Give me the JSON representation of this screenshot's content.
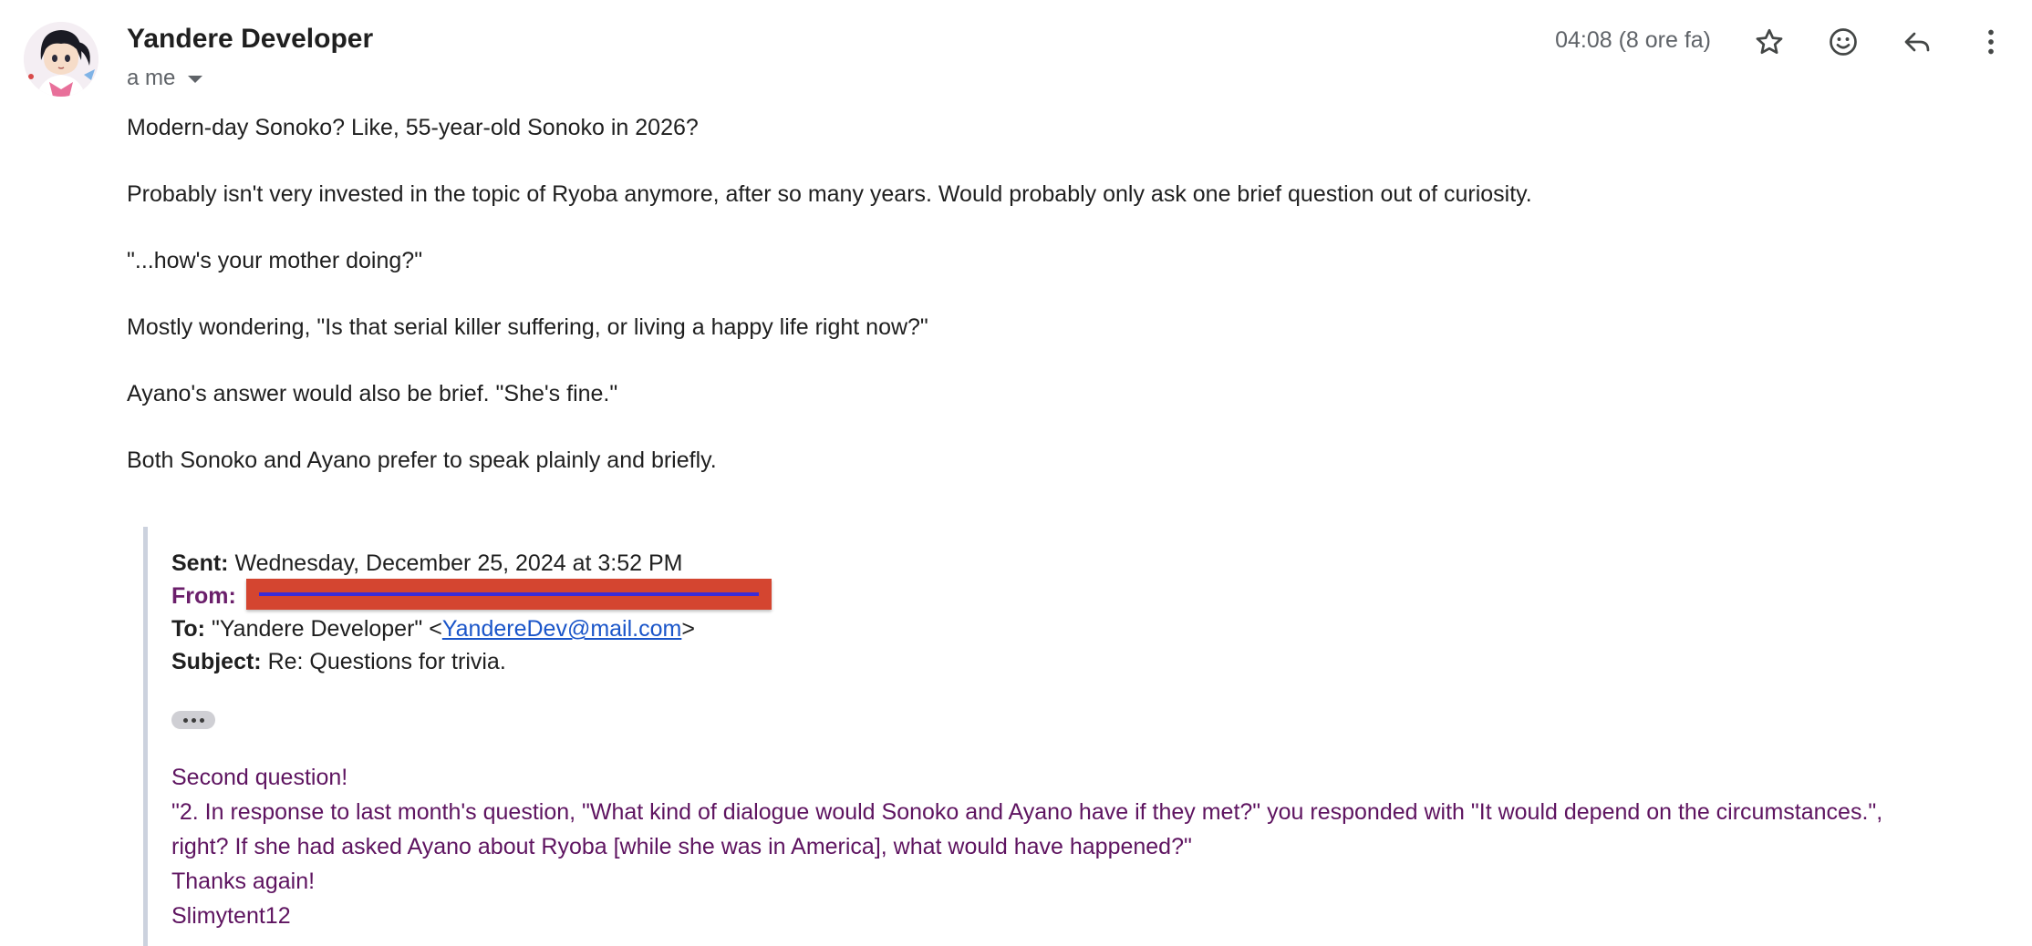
{
  "header": {
    "sender_name": "Yandere Developer",
    "recipient_label": "a me",
    "timestamp": "04:08 (8 ore fa)"
  },
  "actions": [
    {
      "name": "star",
      "icon": "star-icon"
    },
    {
      "name": "react",
      "icon": "emoji-icon"
    },
    {
      "name": "reply",
      "icon": "reply-icon"
    },
    {
      "name": "more",
      "icon": "more-vert-icon"
    }
  ],
  "body": {
    "paragraphs": [
      "Modern-day Sonoko? Like, 55-year-old Sonoko in 2026?",
      "Probably isn't very invested in the topic of Ryoba anymore, after so many years. Would probably only ask one brief question out of curiosity.",
      "\"...how's your mother doing?\"",
      "Mostly wondering, \"Is that serial killer suffering, or living a happy life right now?\"",
      "Ayano's answer would also be brief. \"She's fine.\"",
      "Both Sonoko and Ayano prefer to speak plainly and briefly."
    ]
  },
  "quoted": {
    "sent_label": "Sent:",
    "sent_value": "Wednesday, December 25, 2024 at 3:52 PM",
    "from_label": "From:",
    "to_label": "To:",
    "to_name": "\"Yandere Developer\" <",
    "to_email": "YandereDev@mail.com",
    "to_close": ">",
    "subject_label": "Subject:",
    "subject_value": "Re: Questions for trivia.",
    "lines": [
      "Second question!",
      "\"2. In response to last month's question, \"What kind of dialogue would Sonoko and Ayano have if they met?\" you responded with \"It would depend on the circumstances.\",",
      "right? If she had asked Ayano about Ryoba [while she was in America], what would have happened?\"",
      "Thanks again!",
      "Slimytent12"
    ]
  },
  "colors": {
    "quoted_text": "#5e1460",
    "redaction": "#d44530",
    "link": "#1a55c9"
  }
}
